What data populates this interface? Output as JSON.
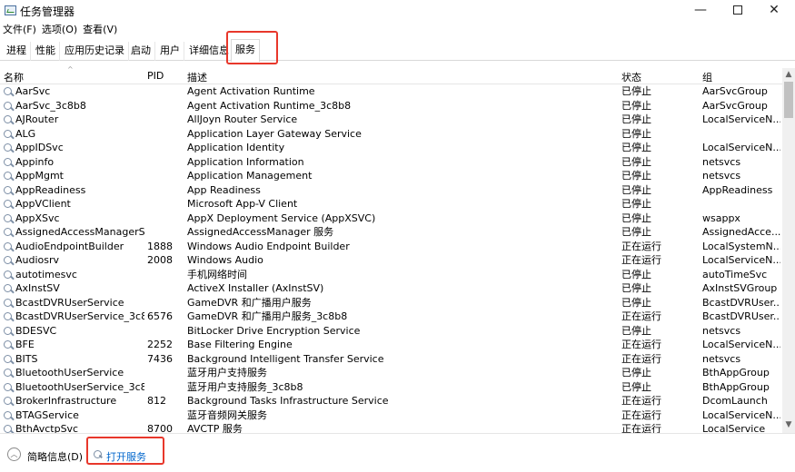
{
  "window": {
    "title": "任务管理器",
    "controls": {
      "minimize": "—",
      "close": "✕"
    }
  },
  "menu": [
    "文件(F)",
    "选项(O)",
    "查看(V)"
  ],
  "tabs": [
    {
      "label": "进程",
      "active": false
    },
    {
      "label": "性能",
      "active": false
    },
    {
      "label": "应用历史记录",
      "active": false
    },
    {
      "label": "启动",
      "active": false
    },
    {
      "label": "用户",
      "active": false
    },
    {
      "label": "详细信息",
      "active": false
    },
    {
      "label": "服务",
      "active": true
    }
  ],
  "columns": {
    "name": "名称",
    "pid": "PID",
    "desc": "描述",
    "status": "状态",
    "group": "组"
  },
  "services": [
    {
      "name": "AarSvc",
      "pid": "",
      "desc": "Agent Activation Runtime",
      "status": "已停止",
      "group": "AarSvcGroup"
    },
    {
      "name": "AarSvc_3c8b8",
      "pid": "",
      "desc": "Agent Activation Runtime_3c8b8",
      "status": "已停止",
      "group": "AarSvcGroup"
    },
    {
      "name": "AJRouter",
      "pid": "",
      "desc": "AllJoyn Router Service",
      "status": "已停止",
      "group": "LocalServiceN..."
    },
    {
      "name": "ALG",
      "pid": "",
      "desc": "Application Layer Gateway Service",
      "status": "已停止",
      "group": ""
    },
    {
      "name": "AppIDSvc",
      "pid": "",
      "desc": "Application Identity",
      "status": "已停止",
      "group": "LocalServiceN..."
    },
    {
      "name": "Appinfo",
      "pid": "",
      "desc": "Application Information",
      "status": "已停止",
      "group": "netsvcs"
    },
    {
      "name": "AppMgmt",
      "pid": "",
      "desc": "Application Management",
      "status": "已停止",
      "group": "netsvcs"
    },
    {
      "name": "AppReadiness",
      "pid": "",
      "desc": "App Readiness",
      "status": "已停止",
      "group": "AppReadiness"
    },
    {
      "name": "AppVClient",
      "pid": "",
      "desc": "Microsoft App-V Client",
      "status": "已停止",
      "group": ""
    },
    {
      "name": "AppXSvc",
      "pid": "",
      "desc": "AppX Deployment Service (AppXSVC)",
      "status": "已停止",
      "group": "wsappx"
    },
    {
      "name": "AssignedAccessManagerS...",
      "pid": "",
      "desc": "AssignedAccessManager 服务",
      "status": "已停止",
      "group": "AssignedAcce..."
    },
    {
      "name": "AudioEndpointBuilder",
      "pid": "1888",
      "desc": "Windows Audio Endpoint Builder",
      "status": "正在运行",
      "group": "LocalSystemN..."
    },
    {
      "name": "Audiosrv",
      "pid": "2008",
      "desc": "Windows Audio",
      "status": "正在运行",
      "group": "LocalServiceN..."
    },
    {
      "name": "autotimesvc",
      "pid": "",
      "desc": "手机网络时间",
      "status": "已停止",
      "group": "autoTimeSvc"
    },
    {
      "name": "AxInstSV",
      "pid": "",
      "desc": "ActiveX Installer (AxInstSV)",
      "status": "已停止",
      "group": "AxInstSVGroup"
    },
    {
      "name": "BcastDVRUserService",
      "pid": "",
      "desc": "GameDVR 和广播用户服务",
      "status": "已停止",
      "group": "BcastDVRUser..."
    },
    {
      "name": "BcastDVRUserService_3c8...",
      "pid": "6576",
      "desc": "GameDVR 和广播用户服务_3c8b8",
      "status": "正在运行",
      "group": "BcastDVRUser..."
    },
    {
      "name": "BDESVC",
      "pid": "",
      "desc": "BitLocker Drive Encryption Service",
      "status": "已停止",
      "group": "netsvcs"
    },
    {
      "name": "BFE",
      "pid": "2252",
      "desc": "Base Filtering Engine",
      "status": "正在运行",
      "group": "LocalServiceN..."
    },
    {
      "name": "BITS",
      "pid": "7436",
      "desc": "Background Intelligent Transfer Service",
      "status": "正在运行",
      "group": "netsvcs"
    },
    {
      "name": "BluetoothUserService",
      "pid": "",
      "desc": "蓝牙用户支持服务",
      "status": "已停止",
      "group": "BthAppGroup"
    },
    {
      "name": "BluetoothUserService_3c8...",
      "pid": "",
      "desc": "蓝牙用户支持服务_3c8b8",
      "status": "已停止",
      "group": "BthAppGroup"
    },
    {
      "name": "BrokerInfrastructure",
      "pid": "812",
      "desc": "Background Tasks Infrastructure Service",
      "status": "正在运行",
      "group": "DcomLaunch"
    },
    {
      "name": "BTAGService",
      "pid": "",
      "desc": "蓝牙音频网关服务",
      "status": "正在运行",
      "group": "LocalServiceN..."
    },
    {
      "name": "BthAvctpSvc",
      "pid": "8700",
      "desc": "AVCTP 服务",
      "status": "正在运行",
      "group": "LocalService"
    }
  ],
  "footer": {
    "brief": "简略信息(D)",
    "open_services": "打开服务"
  },
  "icons": {
    "service": "gear-magnifier-icon",
    "collapse": "chevron-up-icon",
    "highlight_color": "#e8372b"
  }
}
